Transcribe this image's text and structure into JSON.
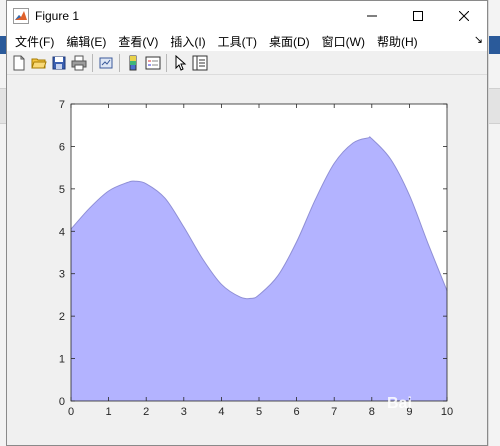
{
  "window": {
    "title": "Figure 1"
  },
  "menu": [
    {
      "label": "文件(F)",
      "name": "menu-file"
    },
    {
      "label": "编辑(E)",
      "name": "menu-edit"
    },
    {
      "label": "查看(V)",
      "name": "menu-view"
    },
    {
      "label": "插入(I)",
      "name": "menu-insert"
    },
    {
      "label": "工具(T)",
      "name": "menu-tools"
    },
    {
      "label": "桌面(D)",
      "name": "menu-desktop"
    },
    {
      "label": "窗口(W)",
      "name": "menu-window"
    },
    {
      "label": "帮助(H)",
      "name": "menu-help"
    }
  ],
  "toolbar": [
    {
      "name": "new-figure-icon"
    },
    {
      "name": "open-file-icon"
    },
    {
      "name": "save-icon"
    },
    {
      "name": "print-icon"
    },
    {
      "sep": true
    },
    {
      "name": "link-plot-icon"
    },
    {
      "sep": true
    },
    {
      "name": "insert-colorbar-icon"
    },
    {
      "name": "insert-legend-icon"
    },
    {
      "sep": true
    },
    {
      "name": "edit-plot-arrow-icon"
    },
    {
      "name": "property-inspector-icon"
    }
  ],
  "colors": {
    "fill": "#b3b3ff",
    "edge": "#8f8fd6",
    "axes_bg": "#ffffff"
  },
  "chart_data": {
    "type": "area",
    "xlim": [
      0,
      10
    ],
    "ylim": [
      0,
      7
    ],
    "xticks": [
      0,
      1,
      2,
      3,
      4,
      5,
      6,
      7,
      8,
      9,
      10
    ],
    "yticks": [
      0,
      1,
      2,
      3,
      4,
      5,
      6,
      7
    ],
    "grid": false,
    "x": [
      0,
      0.5,
      1,
      1.5,
      1.7,
      2,
      2.5,
      3,
      3.5,
      4,
      4.5,
      4.8,
      5,
      5.5,
      6,
      6.5,
      7,
      7.5,
      7.9,
      8,
      8.5,
      9,
      9.5,
      10
    ],
    "y": [
      4.05,
      4.55,
      4.95,
      5.15,
      5.18,
      5.12,
      4.78,
      4.1,
      3.35,
      2.75,
      2.45,
      2.42,
      2.5,
      2.95,
      3.75,
      4.75,
      5.6,
      6.08,
      6.2,
      6.18,
      5.7,
      4.85,
      3.7,
      2.6
    ]
  }
}
